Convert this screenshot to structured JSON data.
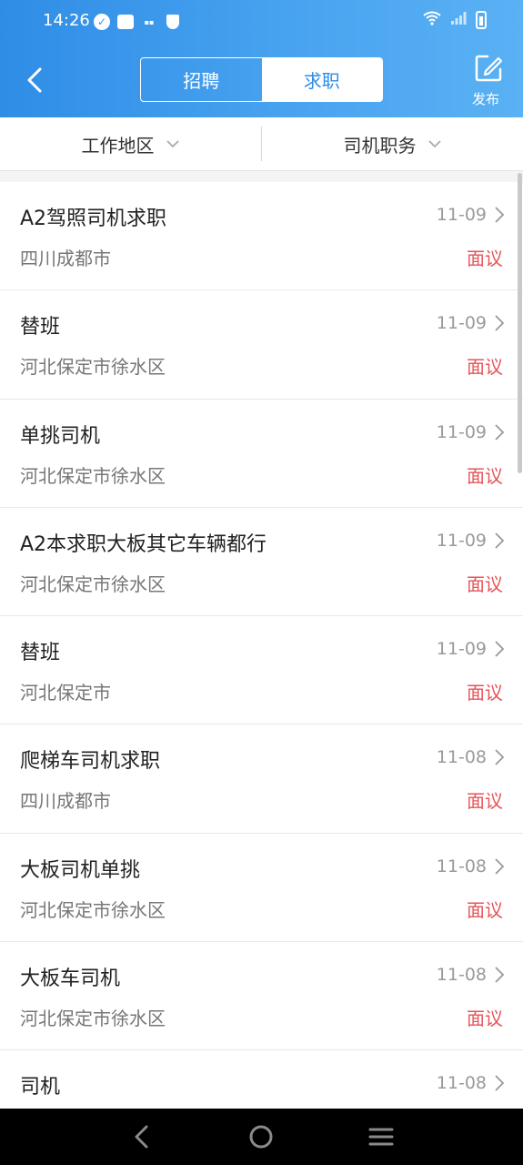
{
  "status_bar": {
    "time": "14:26",
    "icons": [
      "check-circle-icon",
      "mail-icon",
      "app-notification-icon",
      "shield-icon"
    ],
    "right_icons": [
      "wifi-icon",
      "signal-icon",
      "battery-charging-icon"
    ]
  },
  "header": {
    "back_icon": "back-arrow-icon",
    "tabs": [
      {
        "label": "招聘",
        "active": false
      },
      {
        "label": "求职",
        "active": true
      }
    ],
    "publish_label": "发布",
    "publish_icon": "edit-icon",
    "color": "#3a97ea"
  },
  "filters": [
    {
      "label": "工作地区"
    },
    {
      "label": "司机职务"
    }
  ],
  "listings": [
    {
      "title": "A2驾照司机求职",
      "date": "11-09",
      "location": "四川成都市",
      "salary": "面议"
    },
    {
      "title": "替班",
      "date": "11-09",
      "location": "河北保定市徐水区",
      "salary": "面议"
    },
    {
      "title": "单挑司机",
      "date": "11-09",
      "location": "河北保定市徐水区",
      "salary": "面议"
    },
    {
      "title": "A2本求职大板其它车辆都行",
      "date": "11-09",
      "location": "河北保定市徐水区",
      "salary": "面议"
    },
    {
      "title": "替班",
      "date": "11-09",
      "location": "河北保定市",
      "salary": "面议"
    },
    {
      "title": "爬梯车司机求职",
      "date": "11-08",
      "location": "四川成都市",
      "salary": "面议"
    },
    {
      "title": "大板司机单挑",
      "date": "11-08",
      "location": "河北保定市徐水区",
      "salary": "面议"
    },
    {
      "title": "大板车司机",
      "date": "11-08",
      "location": "河北保定市徐水区",
      "salary": "面议"
    },
    {
      "title": "司机",
      "date": "11-08",
      "location": "",
      "salary": ""
    }
  ],
  "nav_bar": [
    "back-triangle-icon",
    "home-circle-icon",
    "menu-icon"
  ],
  "colors": {
    "salary": "#e6555a",
    "accent": "#2f8de6"
  }
}
